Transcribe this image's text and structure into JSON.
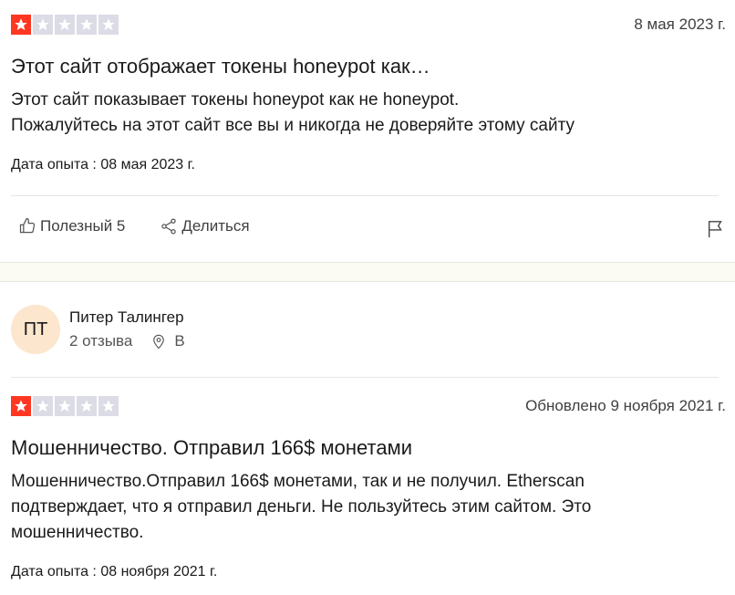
{
  "review1": {
    "rating": 1,
    "date": "8 мая 2023 г.",
    "title": "Этот сайт отображает токены honeypot как…",
    "body_lines": [
      "Этот сайт показывает токены honeypot как не honeypot.",
      "Пожалуйтесь на этот сайт все вы и никогда не доверяйте этому сайту"
    ],
    "experience": "Дата опыта : 08 мая 2023 г.",
    "useful_label": "Полезный 5",
    "share_label": "Делиться"
  },
  "review2": {
    "author_initials": "ПТ",
    "author_name": "Питер Талингер",
    "reviews_count": "2 отзыва",
    "location": "В",
    "rating": 1,
    "date": "Обновлено 9 ноября 2021 г.",
    "title": "Мошенничество. Отправил 166$ монетами",
    "body_lines": [
      "Мошенничество.Отправил 166$ монетами, так и не получил. Etherscan",
      "подтверждает, что я отправил деньги. Не пользуйтесь этим сайтом. Это",
      "мошенничество."
    ],
    "experience": "Дата опыта : 08 ноября 2021 г."
  },
  "colors": {
    "star_on": "#ff3722",
    "star_off": "#dcdce6",
    "avatar_bg": "#fde6ce"
  }
}
